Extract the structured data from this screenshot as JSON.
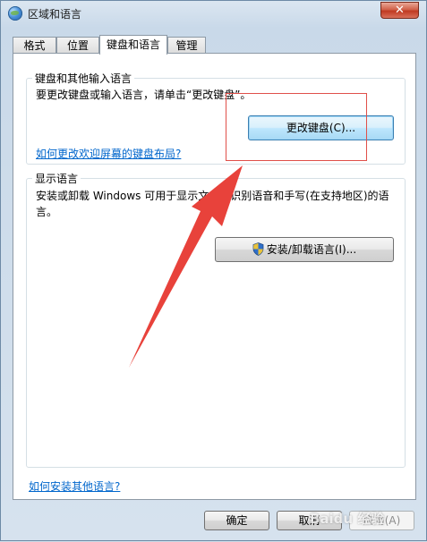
{
  "window": {
    "title": "区域和语言",
    "close_glyph": "✕"
  },
  "tabs": [
    {
      "label": "格式"
    },
    {
      "label": "位置"
    },
    {
      "label": "键盘和语言",
      "active": true
    },
    {
      "label": "管理"
    }
  ],
  "keyboard_group": {
    "title": "键盘和其他输入语言",
    "description": "要更改键盘或输入语言，请单击“更改键盘”。",
    "change_button": "更改键盘(C)...",
    "welcome_link": "如何更改欢迎屏幕的键盘布局?"
  },
  "display_group": {
    "title": "显示语言",
    "description": "安装或卸载 Windows 可用于显示文本和识别语音和手写(在支持地区)的语言。",
    "install_button": "安装/卸载语言(I)..."
  },
  "help_link": "如何安装其他语言?",
  "footer": {
    "ok": "确定",
    "cancel": "取消",
    "apply": "应用(A)"
  },
  "watermark": "Baidu 经验",
  "colors": {
    "annotation_red": "#e8423b",
    "link_blue": "#0066cc"
  }
}
